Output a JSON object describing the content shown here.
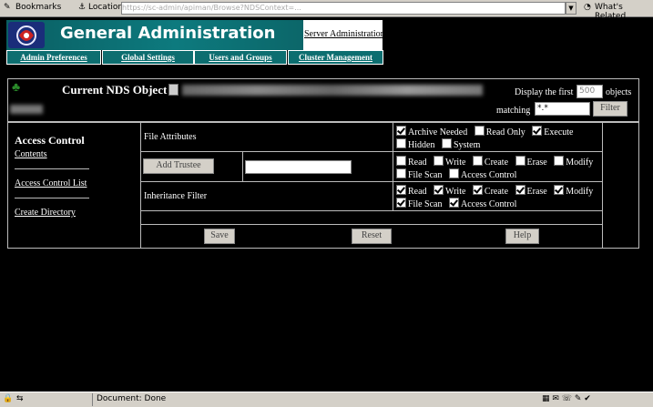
{
  "browser": {
    "bookmarks": "Bookmarks",
    "location_label": "Location:",
    "location_value": "https://sc-admin/apiman/Browse?NDSContext=...",
    "whats_related": "What's Related"
  },
  "banner": {
    "title": "General Administration",
    "server_admin": "Server Administration"
  },
  "nav": {
    "tabs": [
      "Admin Preferences",
      "Global Settings",
      "Users and Groups",
      "Cluster Management"
    ]
  },
  "nds": {
    "title": "Current NDS Object",
    "display_first_label": "Display the first",
    "display_first_value": "500",
    "objects_label": "objects",
    "matching_label": "matching",
    "matching_value": "*.*",
    "filter_button": "Filter"
  },
  "sidebar": {
    "heading": "Access Control",
    "links": [
      "Contents",
      "Access Control List",
      "Create Directory"
    ]
  },
  "file_attributes": {
    "label": "File Attributes",
    "row1": [
      {
        "label": "Archive Needed",
        "checked": true
      },
      {
        "label": "Read Only",
        "checked": false
      },
      {
        "label": "Execute",
        "checked": true
      }
    ],
    "row2": [
      {
        "label": "Hidden",
        "checked": false
      },
      {
        "label": "System",
        "checked": false
      }
    ]
  },
  "trustee": {
    "add_button": "Add Trustee",
    "input_value": "",
    "row1": [
      {
        "label": "Read",
        "checked": false
      },
      {
        "label": "Write",
        "checked": false
      },
      {
        "label": "Create",
        "checked": false
      },
      {
        "label": "Erase",
        "checked": false
      },
      {
        "label": "Modify",
        "checked": false
      }
    ],
    "row2": [
      {
        "label": "File Scan",
        "checked": false
      },
      {
        "label": "Access Control",
        "checked": false
      }
    ]
  },
  "inheritance": {
    "label": "Inheritance Filter",
    "row1": [
      {
        "label": "Read",
        "checked": true
      },
      {
        "label": "Write",
        "checked": true
      },
      {
        "label": "Create",
        "checked": true
      },
      {
        "label": "Erase",
        "checked": true
      },
      {
        "label": "Modify",
        "checked": true
      }
    ],
    "row2": [
      {
        "label": "File Scan",
        "checked": true
      },
      {
        "label": "Access Control",
        "checked": true
      }
    ]
  },
  "actions": {
    "save": "Save",
    "reset": "Reset",
    "help": "Help"
  },
  "status": {
    "text": "Document: Done"
  }
}
